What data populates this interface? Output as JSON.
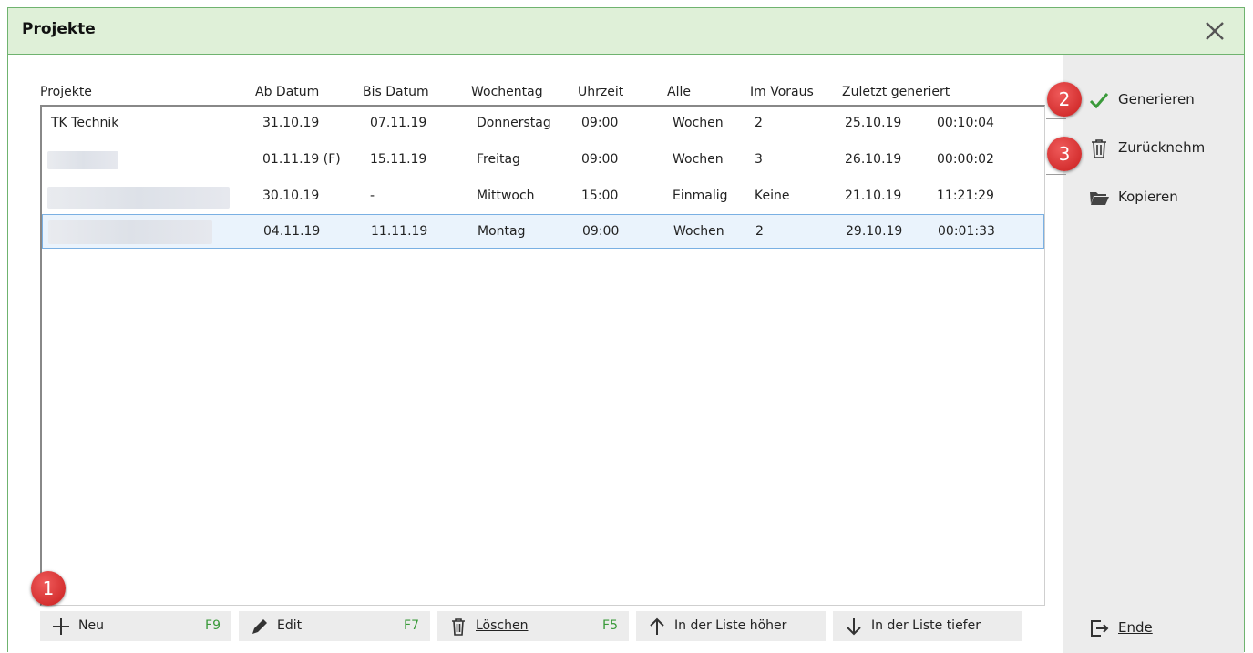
{
  "window": {
    "title": "Projekte",
    "close_icon": "close-icon"
  },
  "table": {
    "headers": [
      "Projekte",
      "Ab Datum",
      "Bis Datum",
      "Wochentag",
      "Uhrzeit",
      "Alle",
      "Im Voraus",
      "Zuletzt generiert"
    ],
    "rows": [
      {
        "name": "TK Technik",
        "ab": "31.10.19",
        "bis": "07.11.19",
        "tag": "Donnerstag",
        "zeit": "09:00",
        "alle": "Wochen",
        "voraus": "2",
        "datum": "25.10.19",
        "uhr": "00:10:04"
      },
      {
        "name": "",
        "ab": "01.11.19 (F)",
        "bis": "15.11.19",
        "tag": "Freitag",
        "zeit": "09:00",
        "alle": "Wochen",
        "voraus": "3",
        "datum": "26.10.19",
        "uhr": "00:00:02"
      },
      {
        "name": "",
        "ab": "30.10.19",
        "bis": "-",
        "tag": "Mittwoch",
        "zeit": "15:00",
        "alle": "Einmalig",
        "voraus": "Keine",
        "datum": "21.10.19",
        "uhr": "11:21:29"
      },
      {
        "name": "",
        "ab": "04.11.19",
        "bis": "11.11.19",
        "tag": "Montag",
        "zeit": "09:00",
        "alle": "Wochen",
        "voraus": "2",
        "datum": "29.10.19",
        "uhr": "00:01:33"
      }
    ]
  },
  "bottom_buttons": {
    "neu": {
      "label": "Neu",
      "key": "F9"
    },
    "edit": {
      "label": "Edit",
      "key": "F7"
    },
    "loeschen": {
      "label": "Löschen",
      "key": "F5"
    },
    "hoeher": {
      "label": "In der Liste höher"
    },
    "tiefer": {
      "label": "In der Liste tiefer"
    }
  },
  "side_buttons": {
    "generieren": {
      "label": "Generieren"
    },
    "zuruecknehmen": {
      "label": "Zurücknehm"
    },
    "kopieren": {
      "label": "Kopieren"
    },
    "ende": {
      "label": "Ende"
    }
  },
  "badges": {
    "b1": "1",
    "b2": "2",
    "b3": "3"
  },
  "colors": {
    "title_bg": "#dff0d8",
    "border": "#6fb36f",
    "accent_green": "#3a9a3a",
    "badge_red": "#d32f2f",
    "selection_bg": "#eaf3fc",
    "selection_border": "#7ab0e3"
  }
}
